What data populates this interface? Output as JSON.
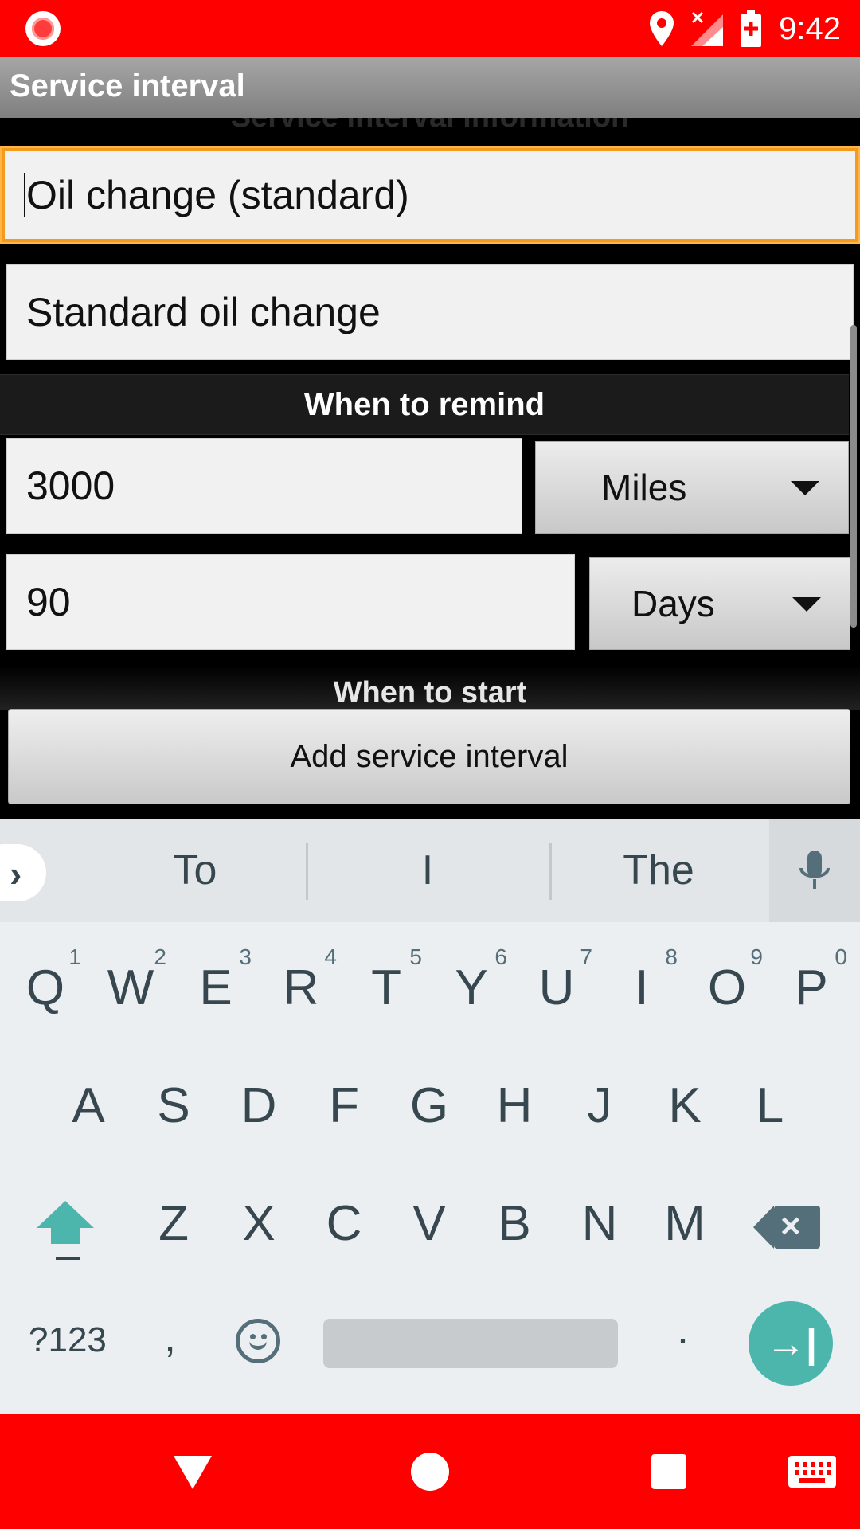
{
  "status_bar": {
    "time": "9:42",
    "icons": [
      "record-icon",
      "location-icon",
      "signal-no-service-icon",
      "battery-charging-icon"
    ]
  },
  "action_bar": {
    "title": "Service interval"
  },
  "form": {
    "section_info_title": "Service interval information",
    "name_value": "Oil change (standard)",
    "description_value": "Standard oil change",
    "section_remind_title": "When to remind",
    "distance_value": "3000",
    "distance_unit": "Miles",
    "time_value": "90",
    "time_unit": "Days",
    "section_start_title": "When to start",
    "add_button_label": "Add service interval"
  },
  "keyboard": {
    "suggestions": [
      "To",
      "I",
      "The"
    ],
    "row1": [
      {
        "key": "Q",
        "hint": "1"
      },
      {
        "key": "W",
        "hint": "2"
      },
      {
        "key": "E",
        "hint": "3"
      },
      {
        "key": "R",
        "hint": "4"
      },
      {
        "key": "T",
        "hint": "5"
      },
      {
        "key": "Y",
        "hint": "6"
      },
      {
        "key": "U",
        "hint": "7"
      },
      {
        "key": "I",
        "hint": "8"
      },
      {
        "key": "O",
        "hint": "9"
      },
      {
        "key": "P",
        "hint": "0"
      }
    ],
    "row2": [
      "A",
      "S",
      "D",
      "F",
      "G",
      "H",
      "J",
      "K",
      "L"
    ],
    "row3": [
      "Z",
      "X",
      "C",
      "V",
      "B",
      "N",
      "M"
    ],
    "symbols_label": "?123",
    "comma_label": ",",
    "period_label": ".",
    "accent_color": "#4db6ac"
  },
  "colors": {
    "status_bar": "#ff0000",
    "nav_bar": "#ff0000",
    "focus_border": "#f39a1f"
  }
}
